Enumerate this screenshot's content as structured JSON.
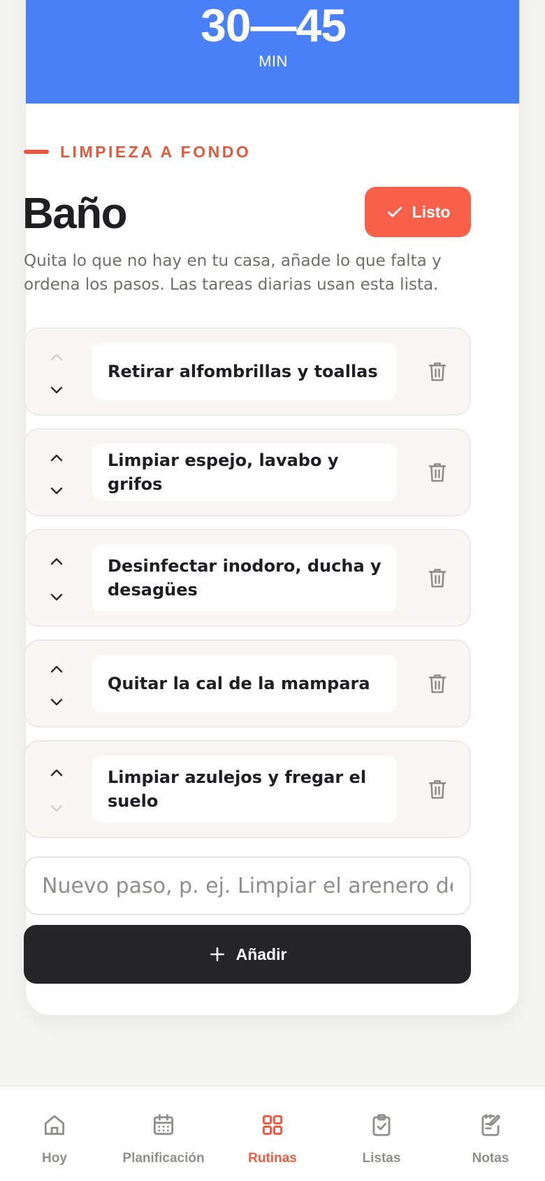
{
  "hero": {
    "time": "30—45",
    "unit": "MIN"
  },
  "category": "LIMPIEZA A FONDO",
  "title": "Baño",
  "done_button": "Listo",
  "description": "Quita lo que no hay en tu casa, añade lo que falta y ordena los pasos. Las tareas diarias usan esta lista.",
  "steps": [
    {
      "label": "Retirar alfombrillas y toallas",
      "can_move_up": false,
      "can_move_down": true
    },
    {
      "label": "Limpiar espejo, lavabo y grifos",
      "can_move_up": true,
      "can_move_down": true
    },
    {
      "label": "Desinfectar inodoro, ducha y desagües",
      "can_move_up": true,
      "can_move_down": true
    },
    {
      "label": "Quitar la cal de la mampara",
      "can_move_up": true,
      "can_move_down": true
    },
    {
      "label": "Limpiar azulejos y fregar el suelo",
      "can_move_up": true,
      "can_move_down": false
    }
  ],
  "new_step": {
    "placeholder": "Nuevo paso, p. ej. Limpiar el arenero del gato",
    "value": ""
  },
  "add_button": "Añadir",
  "tabs": [
    {
      "label": "Hoy",
      "icon": "home-icon",
      "active": false
    },
    {
      "label": "Planificación",
      "icon": "calendar-icon",
      "active": false
    },
    {
      "label": "Rutinas",
      "icon": "grid-icon",
      "active": true
    },
    {
      "label": "Listas",
      "icon": "clipboard-check-icon",
      "active": false
    },
    {
      "label": "Notas",
      "icon": "edit-note-icon",
      "active": false
    }
  ],
  "colors": {
    "hero": "#4a80f7",
    "accent": "#f9604a",
    "dark_button": "#252528",
    "active_tab": "#ee5a42",
    "inactive_tab": "#8f8f8d"
  }
}
